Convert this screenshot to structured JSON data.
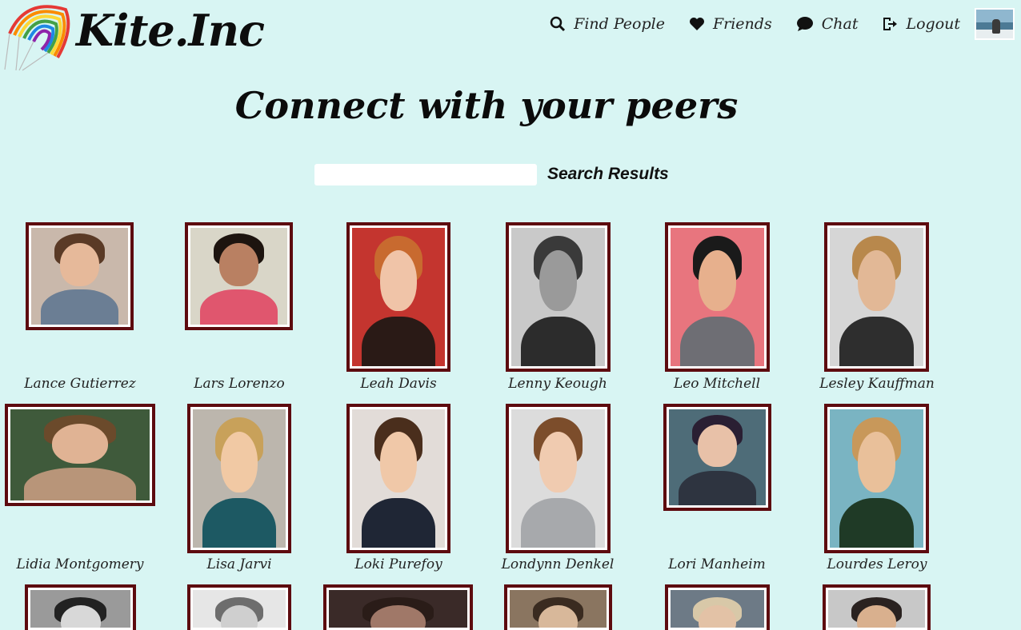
{
  "brand": {
    "name": "Kite.Inc"
  },
  "nav": {
    "items": [
      {
        "label": "Find People",
        "icon": "search-icon"
      },
      {
        "label": "Friends",
        "icon": "heart-icon"
      },
      {
        "label": "Chat",
        "icon": "chat-icon"
      },
      {
        "label": "Logout",
        "icon": "logout-icon"
      }
    ],
    "avatar_icon": "user-avatar-thumbnail"
  },
  "headline": "Connect with your peers",
  "search": {
    "value": "",
    "button_label": "Search Results"
  },
  "colors": {
    "background": "#d8f5f3",
    "frame": "#5d0b0f"
  },
  "people": [
    {
      "name": "Lance Gutierrez"
    },
    {
      "name": "Lars Lorenzo"
    },
    {
      "name": "Leah Davis"
    },
    {
      "name": "Lenny Keough"
    },
    {
      "name": "Leo Mitchell"
    },
    {
      "name": "Lesley Kauffman"
    },
    {
      "name": "Lidia Montgomery"
    },
    {
      "name": "Lisa Jarvi"
    },
    {
      "name": "Loki Purefoy"
    },
    {
      "name": "Londynn Denkel"
    },
    {
      "name": "Lori Manheim"
    },
    {
      "name": "Lourdes Leroy"
    }
  ]
}
